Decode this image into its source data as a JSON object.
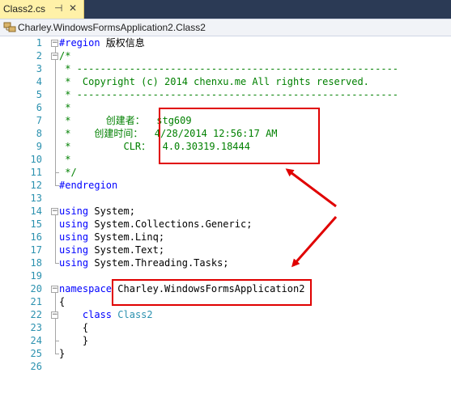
{
  "tab": {
    "filename": "Class2.cs",
    "pin_glyph": "⊣",
    "close_glyph": "✕"
  },
  "nav": {
    "path": "Charley.WindowsFormsApplication2.Class2"
  },
  "lines": [
    {
      "n": "1",
      "segs": [
        [
          "kw",
          "#region"
        ],
        [
          "",
          " 版权信息"
        ]
      ]
    },
    {
      "n": "2",
      "segs": [
        [
          "cm",
          "/*"
        ]
      ]
    },
    {
      "n": "3",
      "segs": [
        [
          "cm",
          " * -------------------------------------------------------"
        ]
      ]
    },
    {
      "n": "4",
      "segs": [
        [
          "cm",
          " *  Copyright (c) 2014 chenxu.me All rights reserved."
        ]
      ]
    },
    {
      "n": "5",
      "segs": [
        [
          "cm",
          " * -------------------------------------------------------"
        ]
      ]
    },
    {
      "n": "6",
      "segs": [
        [
          "cm",
          " *"
        ]
      ]
    },
    {
      "n": "7",
      "segs": [
        [
          "cm",
          " *      创建者：  stg609"
        ]
      ]
    },
    {
      "n": "8",
      "segs": [
        [
          "cm",
          " *    创建时间：  4/28/2014 12:56:17 AM"
        ]
      ]
    },
    {
      "n": "9",
      "segs": [
        [
          "cm",
          " *         CLR：  4.0.30319.18444"
        ]
      ]
    },
    {
      "n": "10",
      "segs": [
        [
          "cm",
          " *"
        ]
      ]
    },
    {
      "n": "11",
      "segs": [
        [
          "cm",
          " */"
        ]
      ]
    },
    {
      "n": "12",
      "segs": [
        [
          "kw",
          "#endregion"
        ]
      ]
    },
    {
      "n": "13",
      "segs": []
    },
    {
      "n": "14",
      "segs": [
        [
          "kw",
          "using"
        ],
        [
          "",
          " System;"
        ]
      ]
    },
    {
      "n": "15",
      "segs": [
        [
          "kw",
          "using"
        ],
        [
          "",
          " System.Collections.Generic;"
        ]
      ]
    },
    {
      "n": "16",
      "segs": [
        [
          "kw",
          "using"
        ],
        [
          "",
          " System.Linq;"
        ]
      ]
    },
    {
      "n": "17",
      "segs": [
        [
          "kw",
          "using"
        ],
        [
          "",
          " System.Text;"
        ]
      ]
    },
    {
      "n": "18",
      "segs": [
        [
          "kw",
          "using"
        ],
        [
          "",
          " System.Threading.Tasks;"
        ]
      ]
    },
    {
      "n": "19",
      "segs": []
    },
    {
      "n": "20",
      "segs": [
        [
          "kw",
          "namespace"
        ],
        [
          "",
          " Charley.WindowsFormsApplication2"
        ]
      ]
    },
    {
      "n": "21",
      "segs": [
        [
          "",
          "{"
        ]
      ]
    },
    {
      "n": "22",
      "segs": [
        [
          "kw",
          "    class"
        ],
        [
          "",
          " "
        ],
        [
          "ty",
          "Class2"
        ]
      ]
    },
    {
      "n": "23",
      "segs": [
        [
          "",
          "    {"
        ]
      ]
    },
    {
      "n": "24",
      "segs": [
        [
          "",
          "    }"
        ]
      ]
    },
    {
      "n": "25",
      "segs": [
        [
          "",
          "}"
        ]
      ]
    },
    {
      "n": "26",
      "segs": []
    }
  ],
  "icons": {
    "class_icon": "class-icon",
    "fold_minus": "−"
  },
  "colors": {
    "keyword": "#0000ff",
    "comment": "#008000",
    "type": "#2b91af",
    "line_number": "#2b91af",
    "annotation": "#e00000",
    "tab_active": "#fff1a8"
  }
}
